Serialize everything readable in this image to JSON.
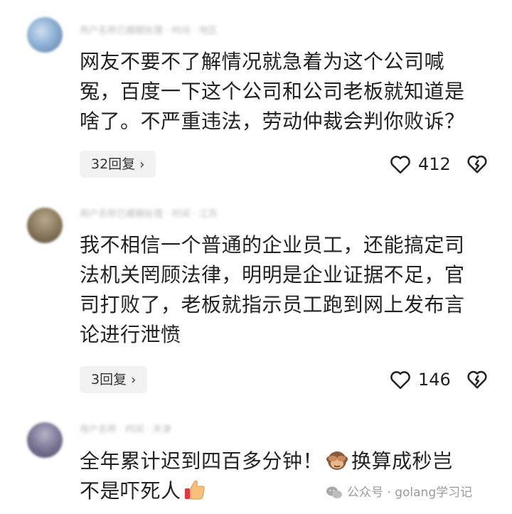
{
  "comments": [
    {
      "meta": "用户名称已模糊处理 · 时间 · 地区",
      "lines": [
        "网友不要不了解情况就急着为这个公司喊",
        "冤，百度一下这个公司和公司老板就知道是",
        "啥了。不严重违法，劳动仲裁会判你败诉？"
      ],
      "reply": "32回复",
      "likes": "412"
    },
    {
      "meta": "用户名称已模糊处理 · 时间 · 江苏",
      "lines": [
        "我不相信一个普通的企业员工，还能搞定司",
        "法机关罔顾法律，明明是企业证据不足，官",
        "司打败了，老板就指示员工跑到网上发布言",
        "论进行泄愤"
      ],
      "reply": "3回复",
      "likes": "146"
    },
    {
      "meta": "用户名称 · 时间 · 天津",
      "line1_a": "全年累计迟到四百多分钟！",
      "line1_b": "换算成秒岂",
      "line2": "不是吓死人"
    }
  ],
  "watermark": "公众号 · golang学习记",
  "icons": {
    "heart": "heart-outline-icon",
    "dislike": "broken-heart-icon",
    "chevron": "chevron-right-icon",
    "monkey": "see-no-evil-monkey-emoji",
    "thumb": "thumbs-up-emoji",
    "wechat": "wechat-icon"
  },
  "colors": {
    "text": "#222222",
    "meta": "#b9b9b9",
    "pill_bg": "#f2f2f2",
    "watermark": "#9a9a9a"
  }
}
